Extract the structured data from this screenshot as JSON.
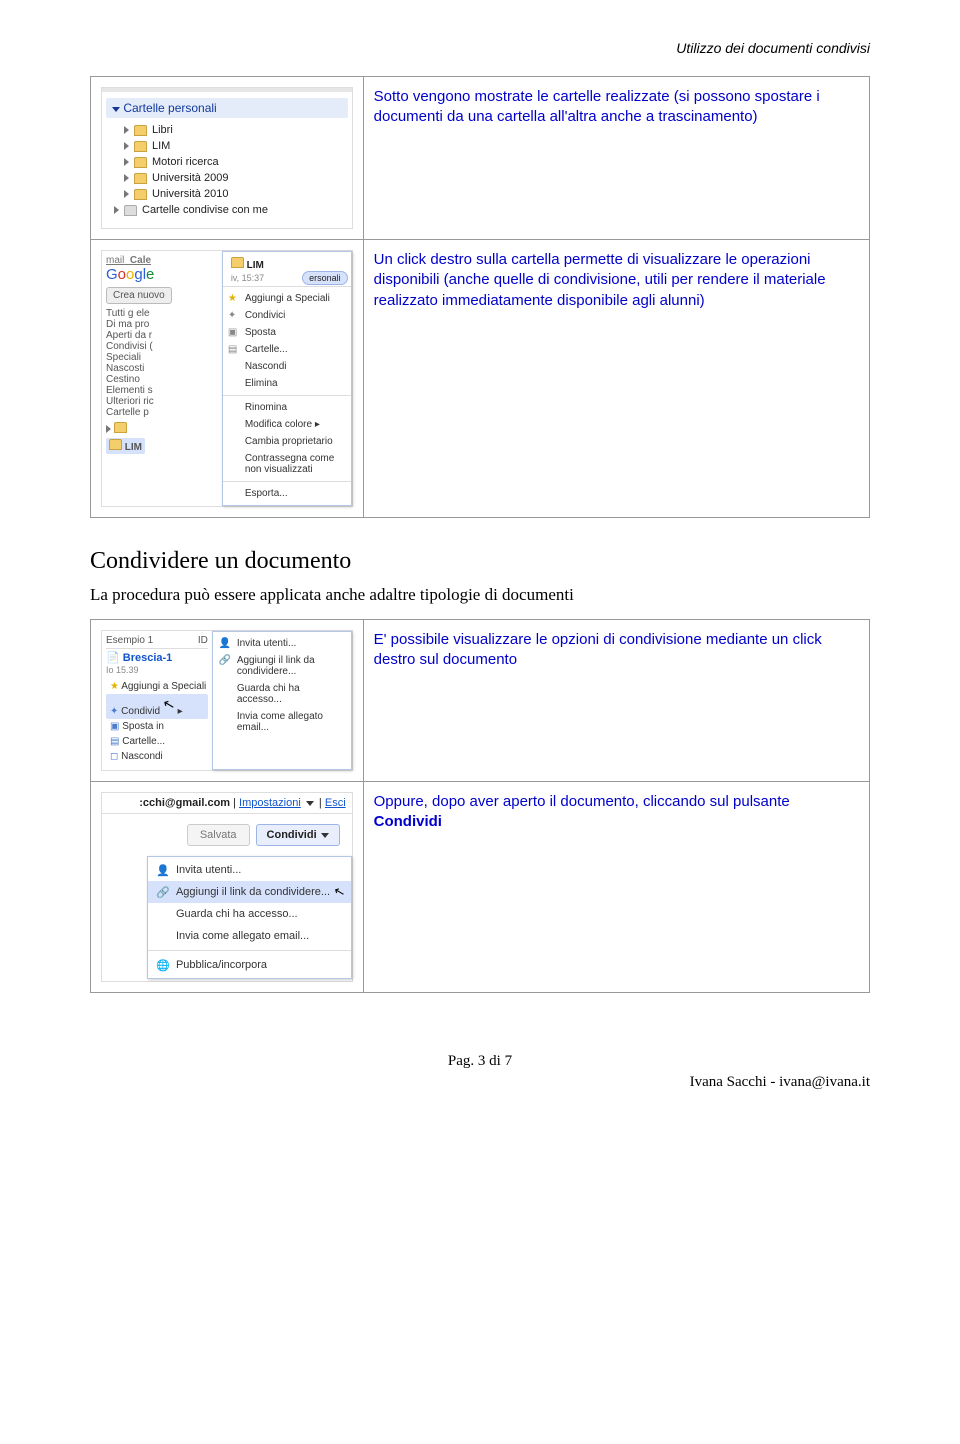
{
  "page": {
    "header": "Utilizzo dei documenti condivisi",
    "footer_page": "Pag. 3 di 7",
    "footer_author": "Ivana Sacchi - ivana@ivana.it"
  },
  "folder_tree": {
    "header": "Cartelle personali",
    "items": [
      "Libri",
      "LIM",
      "Motori ricerca",
      "Università 2009",
      "Università 2010"
    ],
    "shared_row": "Cartelle condivise con me"
  },
  "row1_text": "Sotto vengono mostrate le cartelle realizzate (si possono spostare i documenti da una cartella all'altra anche a trascinamento)",
  "ctx_side": {
    "mail_label": "mail",
    "crea_btn": "Crea nuovo",
    "lim_label": "LIM",
    "time": "iv, 15:37",
    "badge": "ersonali",
    "side_lines": [
      "Tutti g ele",
      "Di ma pro",
      "Aperti da r",
      "Condivisi (",
      "Speciali",
      "Nascosti",
      "Cestino",
      "Elementi s",
      "Ulteriori ric",
      "Cartelle p"
    ]
  },
  "ctx_menu": {
    "items": [
      "Aggiungi a Speciali",
      "Condivici",
      "Sposta",
      "Cartelle...",
      "Nascondi",
      "Elimina",
      "Rinomina",
      "Modifica colore",
      "Cambia proprietario",
      "Contrassegna come non visualizzati",
      "Esporta..."
    ]
  },
  "row2_text": "Un click destro sulla cartella permette di visualizzare le operazioni disponibili (anche quelle di condivisione, utili per rendere il materiale realizzato immediatamente disponibile agli alunni)",
  "section": {
    "heading": "Condividere un documento",
    "desc": "La procedura può essere applicata anche adaltre tipologie di documenti"
  },
  "doc_ctx": {
    "doc_label_prefix": "Esempio 1",
    "id_label": "ID",
    "doc_name": "Brescia-1",
    "doc_time": "Io 15.39",
    "left_rows": [
      "Aggiungi a Speciali",
      "Condivid",
      "Sposta in",
      "Cartelle...",
      "Nascondi"
    ],
    "menu": [
      "Invita utenti...",
      "Aggiungi il link da condividere...",
      "Guarda chi ha accesso...",
      "Invia come allegato email..."
    ]
  },
  "row3_text": "E' possibile visualizzare le opzioni di condivisione mediante un click destro sul documento",
  "condividi": {
    "header_text": "cchi@gmail.com",
    "header_imp": "Impostazioni",
    "header_esci": "Esci",
    "ghost_btn": "Salvata",
    "main_btn": "Condividi",
    "drop": [
      "Invita utenti...",
      "Aggiungi il link da condividere...",
      "Guarda chi ha accesso...",
      "Invia come allegato email...",
      "Pubblica/incorpora"
    ]
  },
  "row4_text_a": "Oppure, dopo aver aperto il documento, cliccando sul pulsante ",
  "row4_text_b": "Condividi"
}
